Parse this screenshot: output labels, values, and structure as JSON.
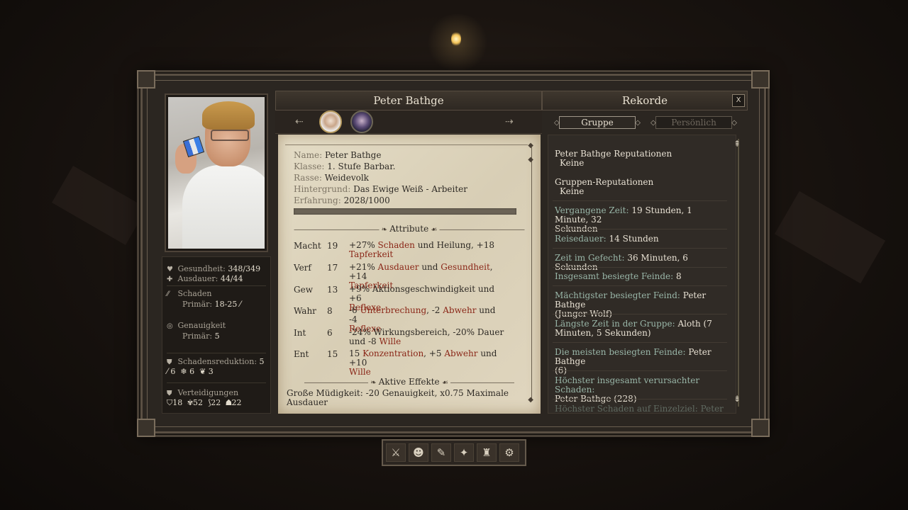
{
  "character": {
    "name": "Peter Bathge",
    "stats": {
      "health_label": "Gesundheit:",
      "health_value": "348/349",
      "endurance_label": "Ausdauer:",
      "endurance_value": "44/44",
      "damage_label": "Schaden",
      "damage_primary_label": "Primär:",
      "damage_primary_value": "18-25",
      "accuracy_label": "Genauigkeit",
      "accuracy_primary_label": "Primär:",
      "accuracy_primary_value": "5",
      "dr_label": "Schadensreduktion:",
      "dr_value": "5",
      "dr_slash": "6",
      "dr_freeze": "6",
      "dr_pierce": "3",
      "defenses_label": "Verteidigungen",
      "def_1": "18",
      "def_2": "52",
      "def_3": "22",
      "def_4": "22"
    }
  },
  "records_title": "Rekorde",
  "close_label": "X",
  "tabs": {
    "group": "Gruppe",
    "personal": "Persönlich"
  },
  "sheet": {
    "name_key": "Name:",
    "name_val": "Peter Bathge",
    "class_key": "Klasse:",
    "class_val": "1. Stufe Barbar.",
    "race_key": "Rasse:",
    "race_val": "Weidevolk",
    "bg_key": "Hintergrund:",
    "bg_val": "Das Ewige Weiß - Arbeiter",
    "xp_key": "Erfahrung:",
    "xp_val": "2028/1000",
    "xp_fill": 1.0,
    "attributes_title": "Attribute",
    "attributes": [
      {
        "name": "Macht",
        "value": "19"
      },
      {
        "name": "Verf",
        "value": "17"
      },
      {
        "name": "Gew",
        "value": "13"
      },
      {
        "name": "Wahr",
        "value": "8"
      },
      {
        "name": "Int",
        "value": "6"
      },
      {
        "name": "Ent",
        "value": "15"
      }
    ],
    "attr_desc": {
      "macht": {
        "a": "+27% ",
        "b": "Schaden",
        "c": " und Heilung, +18",
        "d": "Tapferkeit"
      },
      "verf": {
        "a": "+21% ",
        "b": "Ausdauer",
        "c": " und ",
        "d": "Gesundheit",
        "e": ", +14",
        "f": "Tapferkeit"
      },
      "gew": {
        "a": "+9% Aktionsgeschwindigkeit und +6",
        "b": "Reflexe"
      },
      "wahr": {
        "a": "-6 ",
        "b": "Unterbrechung",
        "c": ", -2 ",
        "d": "Abwehr",
        "e": " und -4",
        "f": "Reflexe"
      },
      "int": {
        "a": "-24% Wirkungsbereich, -20% Dauer",
        "b": "und -8 ",
        "c": "Wille"
      },
      "ent": {
        "a": "15 ",
        "b": "Konzentration",
        "c": ", +5 ",
        "d": "Abwehr",
        "e": " und +10",
        "f": "Wille"
      }
    },
    "effects_title": "Aktive Effekte",
    "effects_text": "Große Müdigkeit: -20 Genauigkeit, x0.75 Maximale Ausdauer"
  },
  "records": {
    "rep_title": "Peter Bathge Reputationen",
    "rep_value": "Keine",
    "group_rep_title": "Gruppen-Reputationen",
    "group_rep_value": "Keine",
    "elapsed_label": "Vergangene Zeit:",
    "elapsed_value": "19 Stunden, 1 Minute, 32",
    "elapsed_value2": "Sekunden",
    "travel_label": "Reisedauer:",
    "travel_value": "14 Stunden",
    "combat_label": "Zeit im Gefecht:",
    "combat_value": "36 Minuten, 6 Sekunden",
    "defeated_label": "Insgesamt besiegte Feinde:",
    "defeated_value": "8",
    "mightiest_label": "Mächtigster besiegter Feind:",
    "mightiest_value": "Peter Bathge",
    "mightiest_value2": "(Junger Wolf)",
    "longest_label": "Längste Zeit in der Gruppe:",
    "longest_value": "Aloth (7",
    "longest_value2": "Minuten, 5 Sekunden)",
    "most_defeated_label": "Die meisten besiegten Feinde:",
    "most_defeated_value": "Peter Bathge",
    "most_defeated_value2": "(6)",
    "highest_damage_label": "Höchster insgesamt verursachter Schaden:",
    "highest_damage_value": "Peter Bathge (228)",
    "highest_single_label": "Höchster Schaden auf Einzelziel: Peter"
  },
  "toolbar": {
    "items": [
      "inventory-icon",
      "character-icon",
      "journal-icon",
      "map-icon",
      "stronghold-icon",
      "settings-icon"
    ]
  }
}
